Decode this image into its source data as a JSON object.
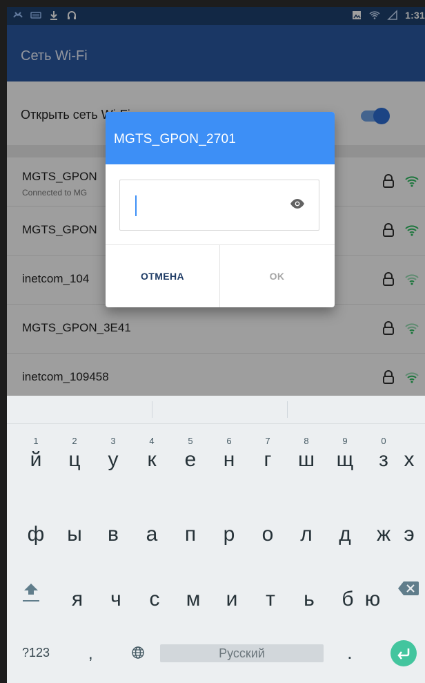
{
  "statusbar": {
    "time": "1:31",
    "icons_left": [
      "missed-call-icon",
      "keyboard-icon",
      "download-icon",
      "headset-icon"
    ],
    "icons_right": [
      "gallery-icon",
      "wifi-status-icon",
      "signal-icon"
    ]
  },
  "appbar": {
    "title": "Сеть Wi-Fi"
  },
  "settings": {
    "toggle_label": "Открыть сеть Wi-Fi",
    "toggle_on": true
  },
  "networks": [
    {
      "ssid": "MGTS_GPON",
      "sub": "Connected to MG"
    },
    {
      "ssid": "MGTS_GPON",
      "sub": ""
    },
    {
      "ssid": "inetcom_104",
      "sub": ""
    },
    {
      "ssid": "MGTS_GPON_3E41",
      "sub": ""
    },
    {
      "ssid": "inetcom_109458",
      "sub": ""
    }
  ],
  "dialog": {
    "title": "MGTS_GPON_2701",
    "password_value": "",
    "cancel_label": "ОТМЕНА",
    "ok_label": "OK"
  },
  "keyboard": {
    "row1": [
      {
        "ch": "й",
        "hint": "1"
      },
      {
        "ch": "ц",
        "hint": "2"
      },
      {
        "ch": "у",
        "hint": "3"
      },
      {
        "ch": "к",
        "hint": "4"
      },
      {
        "ch": "е",
        "hint": "5"
      },
      {
        "ch": "н",
        "hint": "6"
      },
      {
        "ch": "г",
        "hint": "7"
      },
      {
        "ch": "ш",
        "hint": "8"
      },
      {
        "ch": "щ",
        "hint": "9"
      },
      {
        "ch": "з",
        "hint": "0"
      },
      {
        "ch": "х",
        "hint": ""
      }
    ],
    "row2": [
      "ф",
      "ы",
      "в",
      "а",
      "п",
      "р",
      "о",
      "л",
      "д",
      "ж",
      "э"
    ],
    "row3": [
      "я",
      "ч",
      "с",
      "м",
      "и",
      "т",
      "ь",
      "б",
      "ю"
    ],
    "symbols_label": "?123",
    "comma": ",",
    "space_label": "Русский",
    "period": "."
  },
  "colors": {
    "appbar": "#2b5aa3",
    "dialog_header": "#3d8ff6",
    "enter_key": "#43c59e"
  }
}
